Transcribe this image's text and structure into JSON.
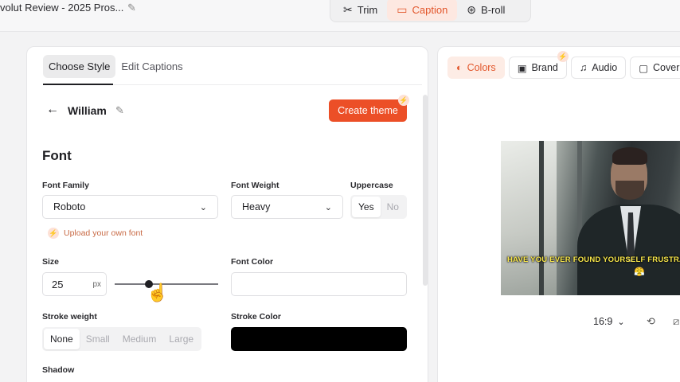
{
  "topbar": {
    "project_title": "volut Review - 2025 Pros...",
    "modes": [
      {
        "label": "Trim",
        "icon": "scissors-icon"
      },
      {
        "label": "Caption",
        "icon": "caption-icon"
      },
      {
        "label": "B-roll",
        "icon": "film-reel-icon"
      }
    ],
    "active_mode": "Caption"
  },
  "left_panel": {
    "tabs": [
      "Choose Style",
      "Edit Captions"
    ],
    "active_tab": "Choose Style",
    "theme_name": "William",
    "create_theme_label": "Create theme",
    "section_title": "Font",
    "font_family": {
      "label": "Font Family",
      "value": "Roboto"
    },
    "font_weight": {
      "label": "Font Weight",
      "value": "Heavy"
    },
    "uppercase": {
      "label": "Uppercase",
      "options": [
        "Yes",
        "No"
      ],
      "selected": "Yes"
    },
    "upload_font_label": "Upload your own font",
    "size": {
      "label": "Size",
      "value": "25",
      "unit": "px"
    },
    "font_color": {
      "label": "Font Color",
      "value": "#ffffff"
    },
    "stroke_weight": {
      "label": "Stroke weight",
      "options": [
        "None",
        "Small",
        "Medium",
        "Large"
      ],
      "selected": "None"
    },
    "stroke_color": {
      "label": "Stroke Color",
      "value": "#000000"
    },
    "shadow": {
      "label": "Shadow"
    }
  },
  "right_panel": {
    "tabs": [
      {
        "label": "Colors",
        "icon": "palette-icon"
      },
      {
        "label": "Brand",
        "icon": "briefcase-icon"
      },
      {
        "label": "Audio",
        "icon": "music-note-icon"
      },
      {
        "label": "Cover",
        "icon": "image-icon"
      }
    ],
    "active_tab": "Colors",
    "preview_caption": "HAVE YOU EVER FOUND YOURSELF FRUSTRA",
    "preview_emoji": "😤",
    "aspect_ratio": "16:9"
  },
  "colors": {
    "accent": "#ec4f27",
    "caption_text": "#f7e64a"
  }
}
